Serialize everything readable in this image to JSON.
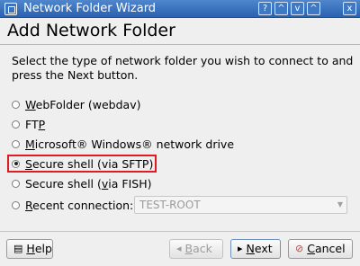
{
  "window": {
    "title": "Network Folder Wizard",
    "controls": {
      "help": "?",
      "shade": "^",
      "min": "v",
      "max": "^",
      "close": "x"
    }
  },
  "page": {
    "heading": "Add Network Folder",
    "instructions": "Select the type of network folder you wish to connect to and press the Next button."
  },
  "options": {
    "webfolder": {
      "mn": "W",
      "rest": "ebFolder (webdav)"
    },
    "ftp": {
      "pre": "FT",
      "mn": "P"
    },
    "windows": {
      "mn": "M",
      "rest": "icrosoft® Windows® network drive"
    },
    "sftp": {
      "mn": "S",
      "rest": "ecure shell (via SFTP)",
      "selected": true
    },
    "fish": {
      "pre": "Secure shell (",
      "mn": "v",
      "rest": "ia FISH)"
    },
    "recent": {
      "mn": "R",
      "rest": "ecent connection:",
      "value": "TEST-ROOT"
    }
  },
  "buttons": {
    "help": {
      "mn": "H",
      "rest": "elp",
      "icon": "help-icon"
    },
    "back": {
      "mn": "B",
      "rest": "ack",
      "icon": "back-arrow-icon"
    },
    "next": {
      "mn": "N",
      "rest": "ext",
      "icon": "next-arrow-icon"
    },
    "cancel": {
      "mn": "C",
      "rest": "ancel",
      "icon": "cancel-icon"
    }
  },
  "colors": {
    "titlebar": "#2a62b1",
    "highlight": "#e01b24"
  }
}
